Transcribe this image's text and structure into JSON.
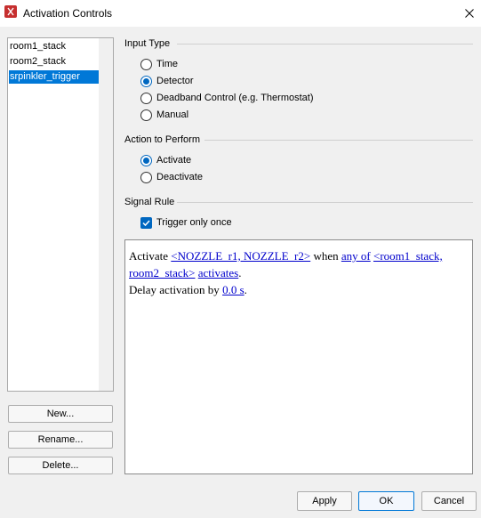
{
  "window": {
    "title": "Activation Controls",
    "app_icon": "pyrosim-icon",
    "close_icon": "close-icon"
  },
  "list": {
    "items": [
      {
        "label": "room1_stack",
        "selected": false
      },
      {
        "label": "room2_stack",
        "selected": false
      },
      {
        "label": "srpinkler_trigger",
        "selected": true
      }
    ]
  },
  "side_buttons": {
    "new_label": "New...",
    "rename_label": "Rename...",
    "delete_label": "Delete..."
  },
  "input_type": {
    "label": "Input Type",
    "options": [
      "Time",
      "Detector",
      "Deadband Control (e.g. Thermostat)",
      "Manual"
    ],
    "selected": "Detector"
  },
  "action": {
    "label": "Action to Perform",
    "options": [
      "Activate",
      "Deactivate"
    ],
    "selected": "Activate"
  },
  "signal_rule": {
    "label": "Signal Rule",
    "trigger_once_label": "Trigger only once",
    "trigger_once_checked": true
  },
  "rule_text": {
    "activate_word": "Activate",
    "targets_link": "<NOZZLE_r1, NOZZLE_r2>",
    "when_word": "when",
    "any_of_link": "any of",
    "sources_link_part1": "<room1_stack,",
    "sources_link_part2": "room2_stack>",
    "activates_link": "activates",
    "period": ".",
    "delay_text": "Delay activation by",
    "delay_link": "0.0 s",
    "delay_period": "."
  },
  "footer": {
    "apply_label": "Apply",
    "ok_label": "OK",
    "cancel_label": "Cancel"
  },
  "colors": {
    "selection": "#0078d7",
    "accent": "#0067c0",
    "link": "#0000cc"
  }
}
